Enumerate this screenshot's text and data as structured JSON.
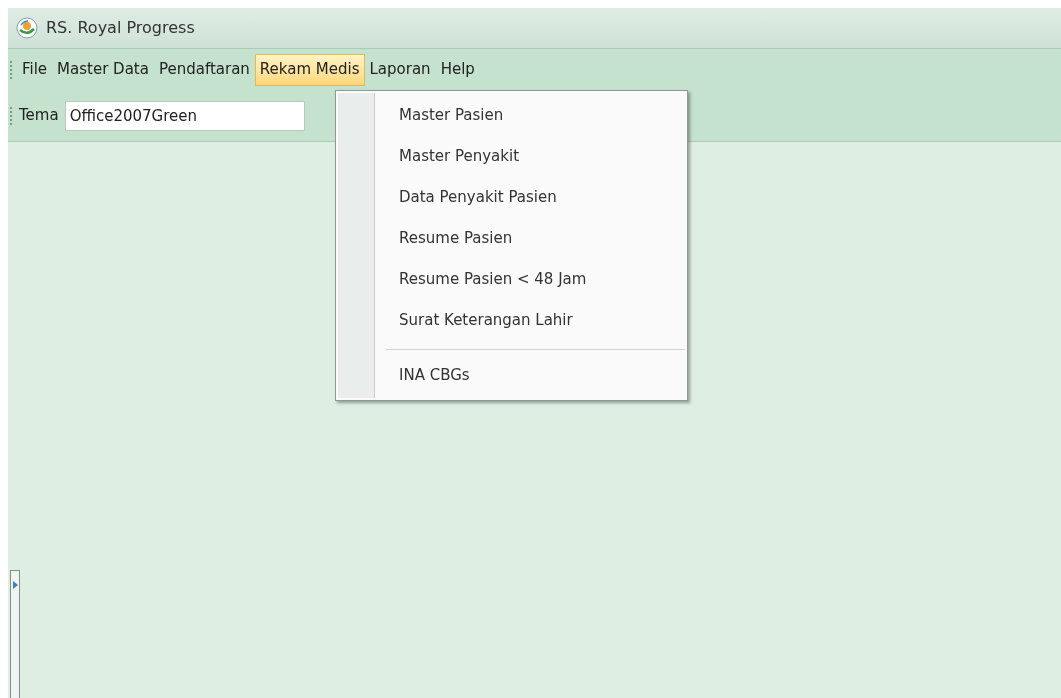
{
  "window": {
    "title": "RS. Royal Progress"
  },
  "menu_bar": [
    {
      "label": "File",
      "selected": false
    },
    {
      "label": "Master Data",
      "selected": false
    },
    {
      "label": "Pendaftaran",
      "selected": false
    },
    {
      "label": "Rekam Medis",
      "selected": true
    },
    {
      "label": "Laporan",
      "selected": false
    },
    {
      "label": "Help",
      "selected": false
    }
  ],
  "toolbar": {
    "label": "Tema",
    "value": "Office2007Green"
  },
  "dropdown_menu": [
    {
      "kind": "item",
      "label": "Master Pasien"
    },
    {
      "kind": "item",
      "label": "Master Penyakit"
    },
    {
      "kind": "item",
      "label": "Data Penyakit Pasien"
    },
    {
      "kind": "item",
      "label": "Resume Pasien"
    },
    {
      "kind": "item",
      "label": "Resume Pasien < 48 Jam"
    },
    {
      "kind": "item",
      "label": "Surat Keterangan Lahir"
    },
    {
      "kind": "separator"
    },
    {
      "kind": "item",
      "label": "INA CBGs"
    }
  ]
}
